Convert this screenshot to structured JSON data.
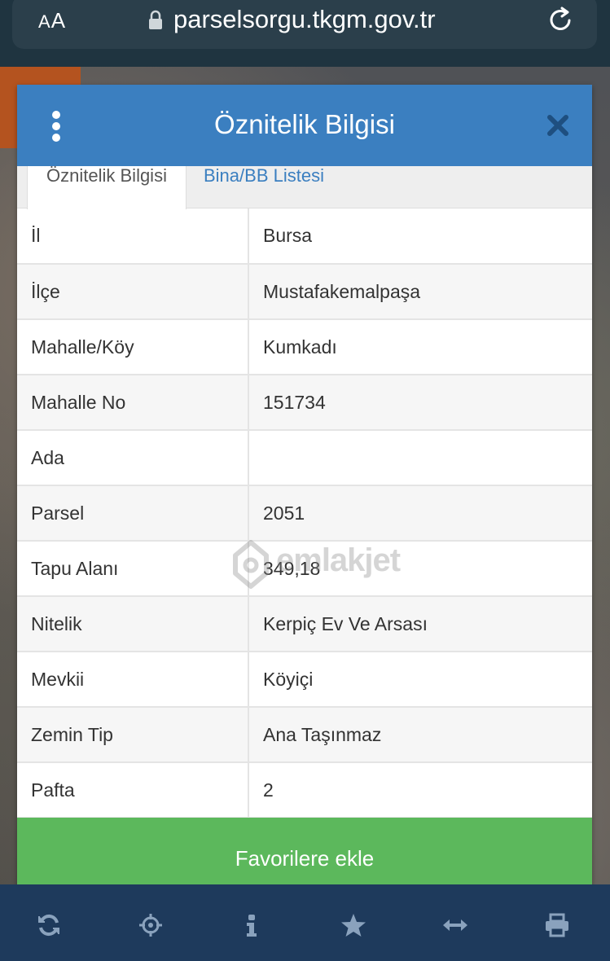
{
  "browser": {
    "aa_label_big": "A",
    "aa_label_small": "A",
    "url": "parselsorgu.tkgm.gov.tr"
  },
  "dialog": {
    "title": "Öznitelik Bilgisi",
    "tabs": [
      {
        "label": "Öznitelik Bilgisi",
        "active": true
      },
      {
        "label": "Bina/BB Listesi",
        "active": false
      }
    ],
    "rows": [
      {
        "key": "İl",
        "value": "Bursa"
      },
      {
        "key": "İlçe",
        "value": "Mustafakemalpaşa"
      },
      {
        "key": "Mahalle/Köy",
        "value": "Kumkadı"
      },
      {
        "key": "Mahalle No",
        "value": "151734"
      },
      {
        "key": "Ada",
        "value": ""
      },
      {
        "key": "Parsel",
        "value": "2051"
      },
      {
        "key": "Tapu Alanı",
        "value": "349,18"
      },
      {
        "key": "Nitelik",
        "value": "Kerpiç Ev Ve Arsası"
      },
      {
        "key": "Mevkii",
        "value": "Köyiçi"
      },
      {
        "key": "Zemin Tip",
        "value": "Ana Taşınmaz"
      },
      {
        "key": "Pafta",
        "value": "2"
      }
    ],
    "favorite_button": "Favorilere ekle"
  },
  "watermark": "emlakjet",
  "toolbar": {
    "icons": [
      "refresh-icon",
      "locate-icon",
      "info-icon",
      "star-icon",
      "measure-icon",
      "print-icon"
    ]
  },
  "colors": {
    "header_blue": "#3b7fc0",
    "button_green": "#5cb85c",
    "toolbar_navy": "#1e3a5c"
  }
}
